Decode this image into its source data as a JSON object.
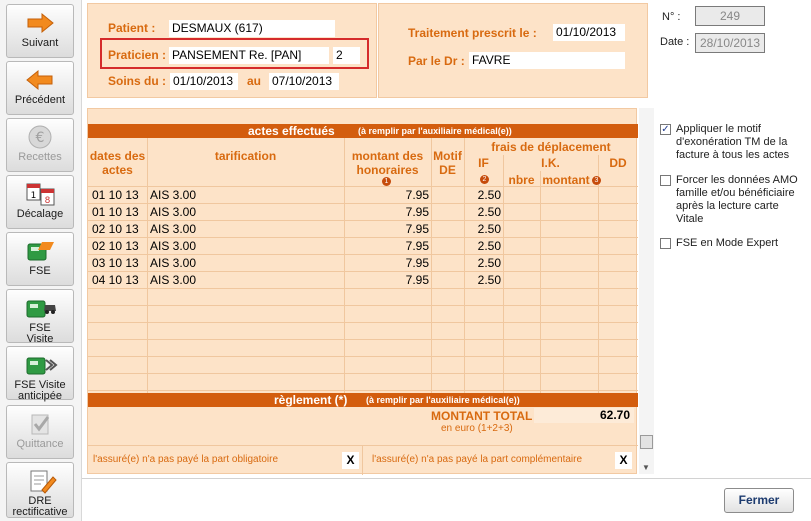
{
  "sidebar": {
    "buttons": [
      {
        "label": "Suivant",
        "icon": "arrow-right-icon"
      },
      {
        "label": "Précédent",
        "icon": "arrow-left-icon"
      },
      {
        "label": "Recettes",
        "icon": "euro-icon"
      },
      {
        "label": "Décalage",
        "icon": "calendar-icon",
        "cal_a": "1",
        "cal_b": "8"
      },
      {
        "label": "FSE",
        "icon": "card-reader-icon"
      },
      {
        "label": "FSE",
        "label2": "Visite",
        "icon": "card-reader-car-icon"
      },
      {
        "label": "FSE Visite",
        "label2": "anticipée",
        "icon": "card-reader-arrow-icon"
      },
      {
        "label": "Quittance",
        "icon": "check-icon"
      },
      {
        "label": "DRE",
        "label2": "rectificative",
        "icon": "document-pen-icon"
      }
    ]
  },
  "header": {
    "patient_label": "Patient :",
    "patient_value": "DESMAUX (617)",
    "praticien_label": "Praticien :",
    "praticien_value": "PANSEMENT Re. [PAN]",
    "praticien_num": "2",
    "soins_label": "Soins du :",
    "soins_from": "01/10/2013",
    "soins_au": "au",
    "soins_to": "07/10/2013",
    "traitement_label": "Traitement prescrit le :",
    "traitement_value": "01/10/2013",
    "dr_label": "Par le Dr :",
    "dr_value": "FAVRE"
  },
  "info": {
    "num_label": "N° :",
    "num_value": "249",
    "date_label": "Date :",
    "date_value": "28/10/2013"
  },
  "options": [
    {
      "checked": true,
      "lines": [
        "Appliquer le motif",
        "d'exonération TM de la",
        "facture à tous les actes"
      ]
    },
    {
      "checked": false,
      "lines": [
        "Forcer les données AMO",
        "famille et/ou bénéficiaire",
        "après la lecture carte",
        "Vitale"
      ]
    },
    {
      "checked": false,
      "lines": [
        "FSE en Mode Expert"
      ]
    }
  ],
  "actes": {
    "title": "actes effectués",
    "subtitle": "(à remplir par l'auxiliaire médical(e))",
    "col_dates": [
      "dates des",
      "actes"
    ],
    "col_tarif": "tarification",
    "col_montant": [
      "montant des",
      "honoraires"
    ],
    "col_motif": [
      "Motif",
      "DE"
    ],
    "col_frais": "frais de déplacement",
    "col_if": "IF",
    "col_ik": "I.K.",
    "col_dd": "DD",
    "col_nbre": "nbre",
    "col_montant_ik": "montant",
    "marker_1": "1",
    "marker_2": "2",
    "marker_3": "3",
    "rows": [
      {
        "date": "01 10 13",
        "tarif": "AIS 3.00",
        "montant": "7.95",
        "if": "2.50"
      },
      {
        "date": "01 10 13",
        "tarif": "AIS 3.00",
        "montant": "7.95",
        "if": "2.50"
      },
      {
        "date": "02 10 13",
        "tarif": "AIS 3.00",
        "montant": "7.95",
        "if": "2.50"
      },
      {
        "date": "02 10 13",
        "tarif": "AIS 3.00",
        "montant": "7.95",
        "if": "2.50"
      },
      {
        "date": "03 10 13",
        "tarif": "AIS 3.00",
        "montant": "7.95",
        "if": "2.50"
      },
      {
        "date": "04 10 13",
        "tarif": "AIS 3.00",
        "montant": "7.95",
        "if": "2.50"
      }
    ]
  },
  "reglement": {
    "title": "règlement (*)",
    "subtitle": "(à remplir par l'auxiliaire médical(e))",
    "total_label": "MONTANT TOTAL",
    "total_sub": "en euro (1+2+3)",
    "total_value": "62.70",
    "oblig_label": "l'assuré(e) n'a pas payé la part obligatoire",
    "oblig_value": "X",
    "compl_label": "l'assuré(e) n'a pas payé la part complémentaire",
    "compl_value": "X"
  },
  "footer": {
    "close_label": "Fermer"
  }
}
